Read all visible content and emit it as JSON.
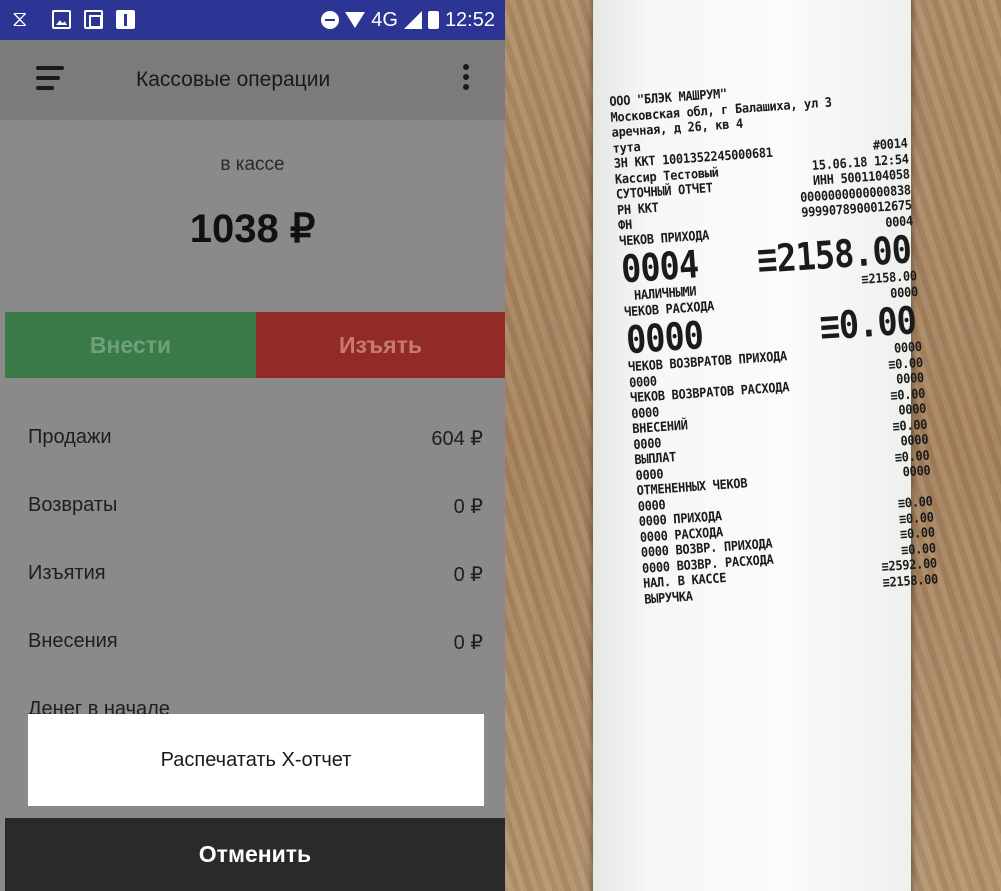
{
  "status_bar": {
    "network": "4G",
    "time": "12:52",
    "icons_left": [
      "hourglass-icon",
      "image-icon",
      "frame-icon",
      "usb-icon"
    ]
  },
  "app_bar": {
    "title": "Кассовые операции"
  },
  "balance": {
    "label": "в кассе",
    "amount": "1038 ₽"
  },
  "actions": {
    "deposit": "Внести",
    "withdraw": "Изъять"
  },
  "stats": [
    {
      "label": "Продажи",
      "value": "604 ₽"
    },
    {
      "label": "Возвраты",
      "value": "0 ₽"
    },
    {
      "label": "Изъятия",
      "value": "0 ₽"
    },
    {
      "label": "Внесения",
      "value": "0 ₽"
    }
  ],
  "stat_partial": "Денег в начале",
  "dialog": {
    "print_x_report": "Распечатать Х-отчет",
    "cancel": "Отменить"
  },
  "colors": {
    "status_bar": "#2c3593",
    "deposit_button": "#3a7a48",
    "withdraw_button": "#922a26",
    "cancel_bar": "#2a2a2a"
  },
  "receipt": {
    "lines": [
      {
        "l": "ООО \"БЛЭК МАШРУМ\"",
        "r": ""
      },
      {
        "l": "Московская обл, г Балашиха, ул 3",
        "r": ""
      },
      {
        "l": "аречная, д 26, кв 4",
        "r": ""
      },
      {
        "l": "тута",
        "r": ""
      },
      {
        "l": "ЗН ККТ 1001352245000681",
        "r": "#0014"
      },
      {
        "l": "Кассир Тестовый",
        "r": "15.06.18 12:54"
      },
      {
        "l": "СУТОЧНЫЙ ОТЧЕТ",
        "r": "ИНН 5001104058"
      },
      {
        "l": "РН ККТ",
        "r": "0000000000000838"
      },
      {
        "l": "ФН",
        "r": "9999078900012675"
      },
      {
        "l": "ЧЕКОВ ПРИХОДА",
        "r": "0004"
      }
    ],
    "big1": {
      "l": "0004",
      "r": "≡2158.00"
    },
    "lines2": [
      {
        "l": "НАЛИЧНЫМИ",
        "r": "≡2158.00"
      },
      {
        "l": "ЧЕКОВ РАСХОДА",
        "r": "0000"
      }
    ],
    "big2": {
      "l": "0000",
      "r": "≡0.00"
    },
    "lines3": [
      {
        "l": "ЧЕКОВ ВОЗВРАТОВ ПРИХОДА",
        "r": "0000"
      },
      {
        "l": "0000",
        "r": "≡0.00"
      },
      {
        "l": "ЧЕКОВ ВОЗВРАТОВ РАСХОДА",
        "r": "0000"
      },
      {
        "l": "0000",
        "r": "≡0.00"
      },
      {
        "l": "ВНЕСЕНИЙ",
        "r": "0000"
      },
      {
        "l": "0000",
        "r": "≡0.00"
      },
      {
        "l": "ВЫПЛАТ",
        "r": "0000"
      },
      {
        "l": "0000",
        "r": "≡0.00"
      },
      {
        "l": "ОТМЕНЕННЫХ ЧЕКОВ",
        "r": "0000"
      },
      {
        "l": "0000",
        "r": ""
      },
      {
        "l": "0000 ПРИХОДА",
        "r": "≡0.00"
      },
      {
        "l": "0000 РАСХОДА",
        "r": "≡0.00"
      },
      {
        "l": "0000 ВОЗВР. ПРИХОДА",
        "r": "≡0.00"
      },
      {
        "l": "0000 ВОЗВР. РАСХОДА",
        "r": "≡0.00"
      },
      {
        "l": "НАЛ. В КАССЕ",
        "r": "≡2592.00"
      },
      {
        "l": "ВЫРУЧКА",
        "r": "≡2158.00"
      }
    ]
  }
}
